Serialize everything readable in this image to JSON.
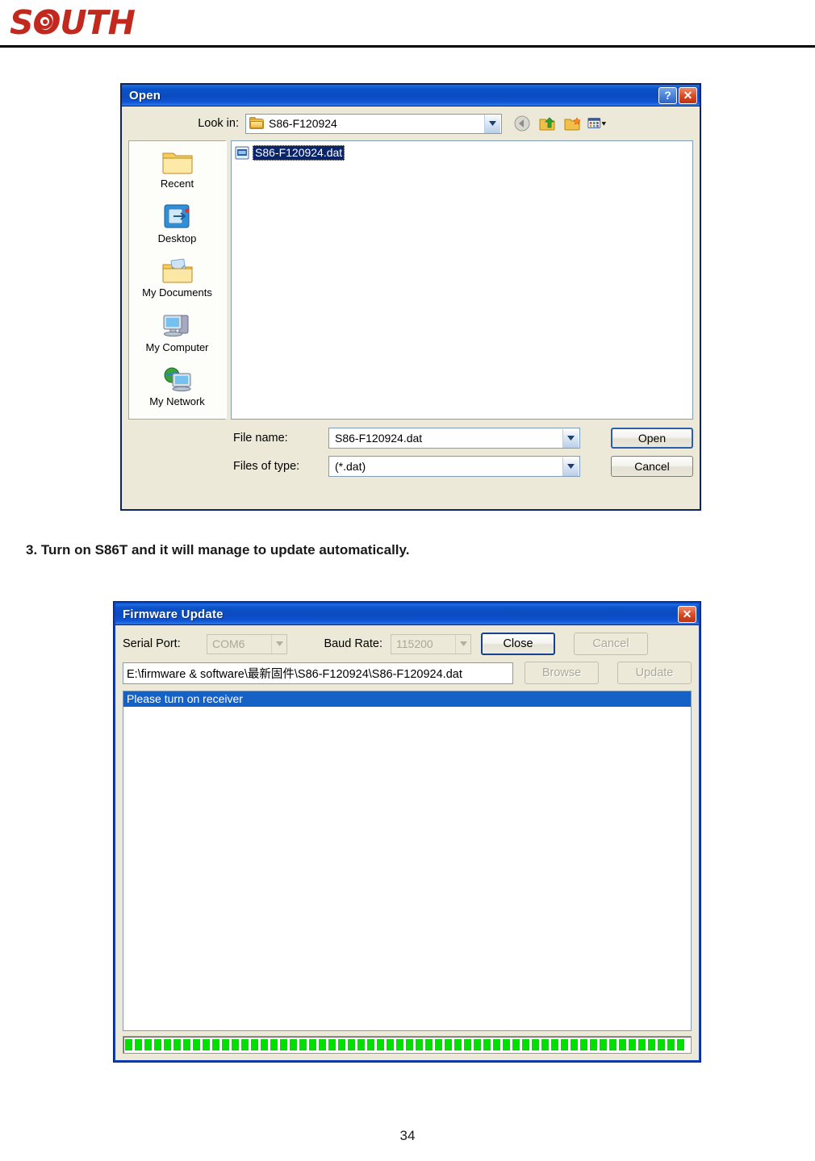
{
  "brand": {
    "name": "SOUTH",
    "color": "#c1281e"
  },
  "open_dialog": {
    "title": "Open",
    "help_button": "?",
    "close_button": "✕",
    "lookin_label": "Look in:",
    "lookin_value": "S86-F120924",
    "toolbar": {
      "back": "back-icon",
      "up": "up-one-level-icon",
      "new_folder": "new-folder-icon",
      "views": "views-icon"
    },
    "places": [
      {
        "label": "Recent",
        "icon": "recent-folder-icon"
      },
      {
        "label": "Desktop",
        "icon": "desktop-icon"
      },
      {
        "label": "My Documents",
        "icon": "my-documents-icon"
      },
      {
        "label": "My Computer",
        "icon": "my-computer-icon"
      },
      {
        "label": "My Network",
        "icon": "my-network-icon"
      }
    ],
    "files": [
      {
        "name": "S86-F120924.dat",
        "selected": true,
        "icon": "dat-file-icon"
      }
    ],
    "filename_label": "File name:",
    "filename_value": "S86-F120924.dat",
    "filetype_label": "Files of type:",
    "filetype_value": "(*.dat)",
    "open_button": "Open",
    "cancel_button": "Cancel"
  },
  "step_text": "3. Turn on S86T and it will manage to update automatically.",
  "firmware_dialog": {
    "title": "Firmware Update",
    "close_button": "✕",
    "serial_port_label": "Serial Port:",
    "serial_port_value": "COM6",
    "baud_rate_label": "Baud Rate:",
    "baud_rate_value": "115200",
    "close_action": "Close",
    "cancel_action": "Cancel",
    "file_path": "E:\\firmware & software\\最新固件\\S86-F120924\\S86-F120924.dat",
    "browse_button": "Browse",
    "update_button": "Update",
    "log_lines": [
      "Please turn on receiver"
    ],
    "progress_percent": 100,
    "progress_color": "#00e000"
  },
  "footer": {
    "page_number": "34"
  }
}
